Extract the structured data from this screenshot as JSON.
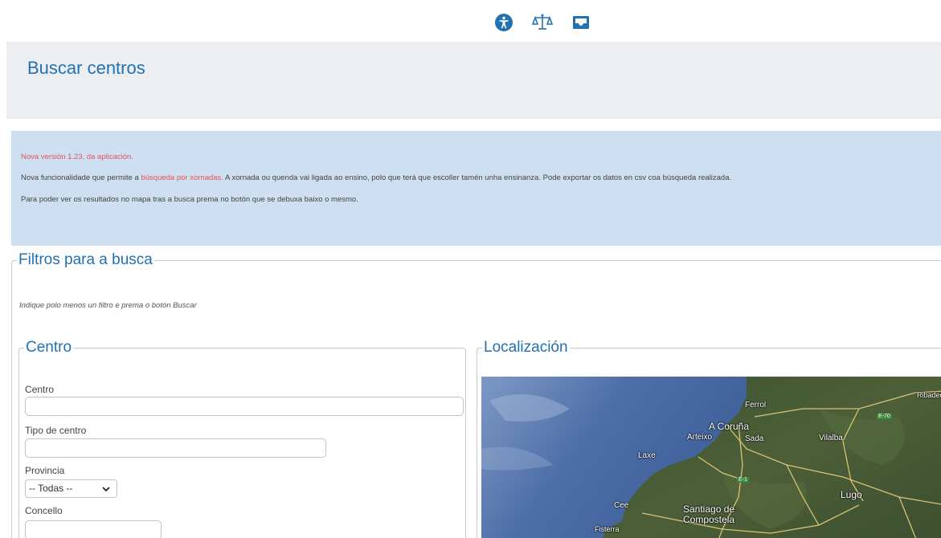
{
  "top_icons": [
    {
      "name": "accessibility-icon",
      "color": "#2271b1"
    },
    {
      "name": "legal-scale-icon",
      "color": "#2271b1"
    },
    {
      "name": "inbox-icon",
      "color": "#2271b1"
    }
  ],
  "header": {
    "title": "Buscar centros"
  },
  "notice": {
    "version": "Nova versión 1.23. da aplicación.",
    "line2_prefix": "Nova funcionalidade que permite a ",
    "line2_link": "búsqueda por xornadas.",
    "line2_suffix": " A xornada ou quenda vai ligada ao ensino, polo que terá que escoller tamén unha ensinanza. Pode exportar os datos en csv coa búsqueda realizada.",
    "line3": "Para poder ver os resultados no mapa tras a busca prema no botón que se debuxa baixo o mesmo."
  },
  "filters": {
    "title": "Filtros para a busca",
    "hint": "Indique polo menos un filtro e prema o botón Buscar",
    "centro": {
      "title": "Centro",
      "centro_label": "Centro",
      "centro_value": "",
      "tipo_label": "Tipo de centro",
      "tipo_value": "",
      "provincia_label": "Provincia",
      "provincia_value": "-- Todas --",
      "concello_label": "Concello",
      "concello_value": ""
    },
    "localizacion": {
      "title": "Localización",
      "map_labels": {
        "ferrol": "Ferrol",
        "coruna": "A Coruña",
        "arteixo": "Arteixo",
        "sada": "Sada",
        "vilalba": "Vilalba",
        "laxe": "Laxe",
        "lugo": "Lugo",
        "cee": "Cee",
        "santiago1": "Santiago de",
        "santiago2": "Compostela",
        "fisterra": "Fisterra",
        "ribadeo": "Ribadeo",
        "e70": "E-70",
        "e1": "E-1"
      }
    }
  },
  "colors": {
    "accent": "#2271b1",
    "notice_bg": "#cddff0",
    "header_bg": "#eceef2",
    "link_red": "#e8535a"
  }
}
